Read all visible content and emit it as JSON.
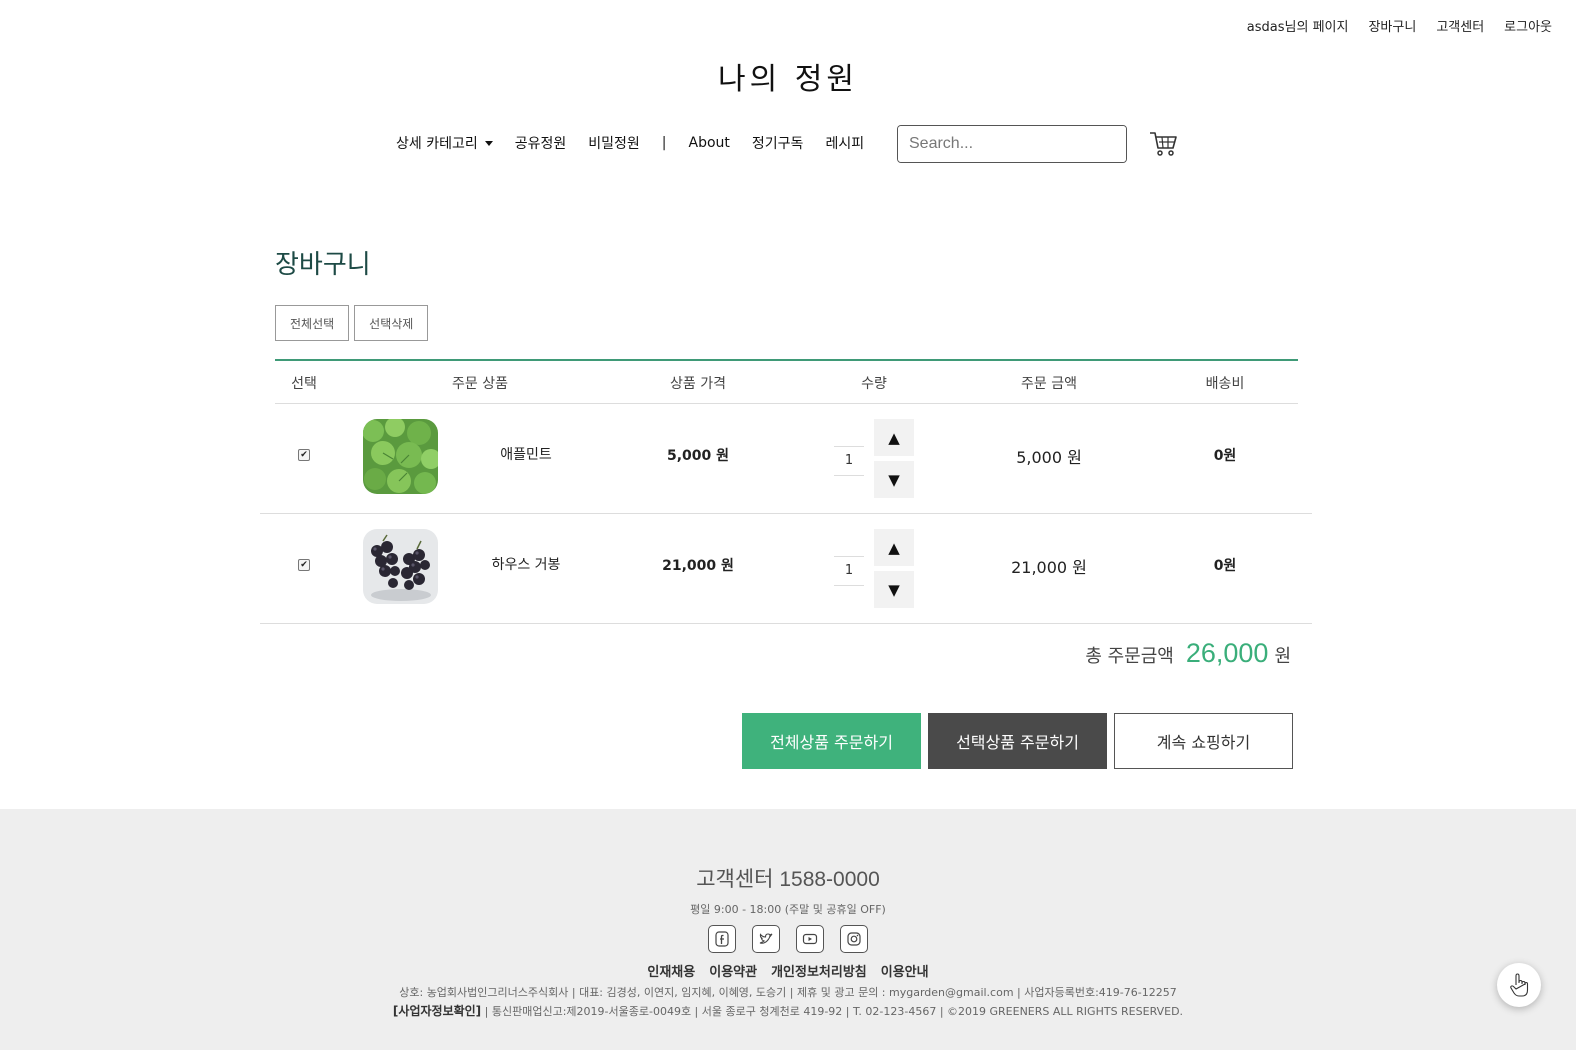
{
  "top_links": [
    "asdas님의 페이지",
    "장바구니",
    "고객센터",
    "로그아웃"
  ],
  "logo": "나의 정원",
  "nav": {
    "dropdown_label": "상세 카테고리",
    "items": [
      "공유정원",
      "비밀정원"
    ],
    "separator": "|",
    "items2": [
      "About",
      "정기구독",
      "레시피"
    ]
  },
  "search": {
    "placeholder": "Search...",
    "button_icon": "search-icon"
  },
  "page_title": "장바구니",
  "buttons": {
    "select_all": "전체선택",
    "delete_selected": "선택삭제"
  },
  "table": {
    "headers": [
      "선택",
      "주문 상품",
      "상품 가격",
      "수량",
      "주문 금액",
      "배송비"
    ],
    "rows": [
      {
        "checked": true,
        "name": "애플민트",
        "price": "5,000 원",
        "qty": "1",
        "amount": "5,000 원",
        "shipping": "0원",
        "image": "mint-leaves"
      },
      {
        "checked": true,
        "name": "하우스 거봉",
        "price": "21,000 원",
        "qty": "1",
        "amount": "21,000 원",
        "shipping": "0원",
        "image": "grapes"
      }
    ],
    "up_symbol": "▲",
    "down_symbol": "▼"
  },
  "total": {
    "label": "총 주문금액",
    "value": "26,000",
    "unit": "원"
  },
  "order_buttons": {
    "order_all": "전체상품 주문하기",
    "order_selected": "선택상품 주문하기",
    "continue": "계속 쇼핑하기"
  },
  "footer": {
    "phone": "고객센터 1588-0000",
    "hours": "평일 9:00 - 18:00 (주말 및 공휴일 OFF)",
    "socials": [
      "facebook-icon",
      "twitter-icon",
      "youtube-icon",
      "instagram-icon"
    ],
    "links": [
      "인재채용",
      "이용약관",
      "개인정보처리방침",
      "이용안내"
    ],
    "info1": "상호: 농업회사법인그리너스주식회사 | 대표: 김경성, 이연지, 임지혜, 이혜영, 도승기 | 제휴 및 광고 문의 : mygarden@gmail.com | 사업자등록번호:419-76-12257",
    "info2_bold": "[사업자정보확인]",
    "info2": " | 통신판매업신고:제2019-서울종로-0049호 | 서울 종로구 청계천로 419-92 | T. 02-123-4567 | ©2019 GREENERS ALL RIGHTS RESERVED."
  },
  "colors": {
    "accent_green": "#3fb27c",
    "title_teal": "#1d4a45",
    "dark_button": "#4a4a4a",
    "footer_bg": "#eeeeee"
  }
}
